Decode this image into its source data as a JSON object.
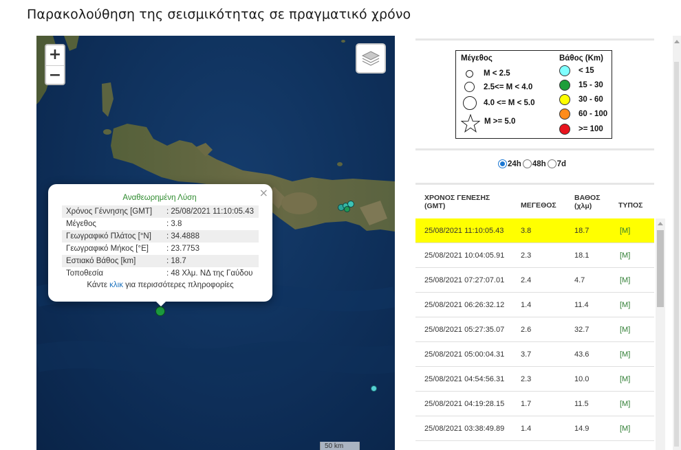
{
  "page": {
    "title": "Παρακολούθηση της σεισμικότητας σε πραγματικό χρόνο"
  },
  "map": {
    "zoom_in": "+",
    "zoom_out": "−",
    "layers_icon": "layers-icon",
    "scale_label": "50 km",
    "popup": {
      "heading": "Αναθεωρημένη Λύση",
      "close": "×",
      "fields": [
        {
          "label": "Χρόνος Γέννησης [GMT]",
          "value": ": 25/08/2021 11:10:05.43"
        },
        {
          "label": "Μέγεθος",
          "value": ": 3.8"
        },
        {
          "label": "Γεωγραφικό Πλάτος [°N]",
          "value": ": 34.4888"
        },
        {
          "label": "Γεωγραφικό Μήκος [°E]",
          "value": ": 23.7753"
        },
        {
          "label": "Εστιακό Βάθος [km]",
          "value": ": 18.7"
        },
        {
          "label": "Τοποθεσία",
          "value": ": 48 Χλμ. ΝΔ της Γαύδου"
        }
      ],
      "footer_before": "Κάντε ",
      "footer_link": "κλικ",
      "footer_after": " για περισσότερες πληροφορίες"
    }
  },
  "legend": {
    "magnitude_title": "Μέγεθος",
    "depth_title": "Βάθος (Km)",
    "magnitude_items": [
      "M  < 2.5",
      "2.5<= M < 4.0",
      "4.0 <= M < 5.0",
      "M >= 5.0"
    ],
    "depth_items": [
      {
        "label": "< 15",
        "color": "#7fffff"
      },
      {
        "label": "15 - 30",
        "color": "#1e9e3a"
      },
      {
        "label": "30 - 60",
        "color": "#ffff00"
      },
      {
        "label": "60 - 100",
        "color": "#ff8c1a"
      },
      {
        "label": ">= 100",
        "color": "#e8141e"
      }
    ]
  },
  "time_range": {
    "options": [
      "24h",
      "48h",
      "7d"
    ],
    "selected": "24h"
  },
  "table": {
    "headers": {
      "time_l1": "ΧΡΟΝΟΣ ΓΕΝΕΣΗΣ",
      "time_l2": "(GMT)",
      "magnitude": "ΜΕΓΕΘΟΣ",
      "depth_l1": "ΒΑΘΟΣ",
      "depth_l2": "(χλμ)",
      "type": "ΤΥΠΟΣ"
    },
    "highlight_color": "#ffff00",
    "rows": [
      {
        "time": "25/08/2021 11:10:05.43",
        "mag": "3.8",
        "depth": "18.7",
        "type": "[M]"
      },
      {
        "time": "25/08/2021 10:04:05.91",
        "mag": "2.3",
        "depth": "18.1",
        "type": "[M]"
      },
      {
        "time": "25/08/2021 07:27:07.01",
        "mag": "2.4",
        "depth": "4.7",
        "type": "[M]"
      },
      {
        "time": "25/08/2021 06:26:32.12",
        "mag": "1.4",
        "depth": "11.4",
        "type": "[M]"
      },
      {
        "time": "25/08/2021 05:27:35.07",
        "mag": "2.6",
        "depth": "32.7",
        "type": "[M]"
      },
      {
        "time": "25/08/2021 05:00:04.31",
        "mag": "3.7",
        "depth": "43.6",
        "type": "[M]"
      },
      {
        "time": "25/08/2021 04:54:56.31",
        "mag": "2.3",
        "depth": "10.0",
        "type": "[M]"
      },
      {
        "time": "25/08/2021 04:19:28.15",
        "mag": "1.7",
        "depth": "11.5",
        "type": "[M]"
      },
      {
        "time": "25/08/2021 03:38:49.89",
        "mag": "1.4",
        "depth": "14.9",
        "type": "[M]"
      }
    ]
  }
}
